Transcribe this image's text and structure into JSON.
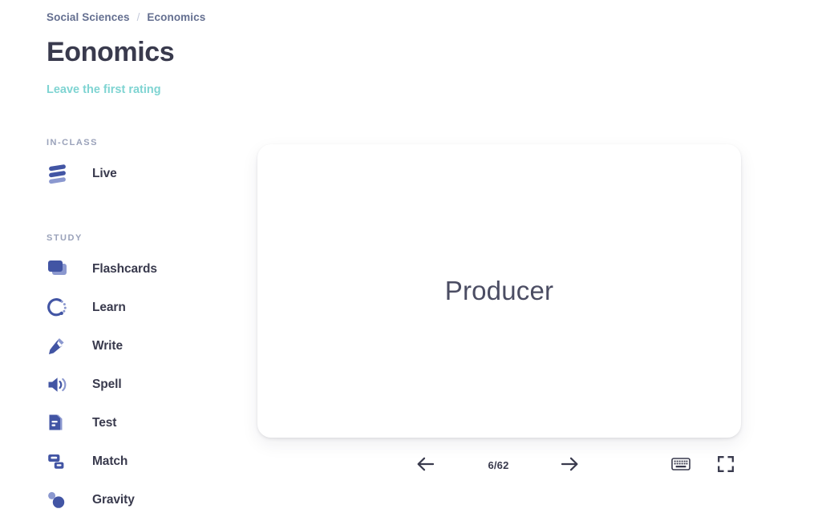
{
  "breadcrumb": {
    "items": [
      "Social Sciences",
      "Economics"
    ],
    "separator": "/"
  },
  "header": {
    "title": "Eonomics",
    "rating_link": "Leave the first rating"
  },
  "sidebar": {
    "groups": [
      {
        "label": "IN-CLASS",
        "items": [
          {
            "label": "Live",
            "icon": "live-bars-icon"
          }
        ]
      },
      {
        "label": "STUDY",
        "items": [
          {
            "label": "Flashcards",
            "icon": "flashcards-stack-icon"
          },
          {
            "label": "Learn",
            "icon": "learn-circle-icon"
          },
          {
            "label": "Write",
            "icon": "write-pen-icon"
          },
          {
            "label": "Spell",
            "icon": "spell-speaker-icon"
          },
          {
            "label": "Test",
            "icon": "test-document-icon"
          },
          {
            "label": "Match",
            "icon": "match-tiles-icon"
          },
          {
            "label": "Gravity",
            "icon": "gravity-asteroid-icon"
          }
        ]
      }
    ]
  },
  "flashcard": {
    "term": "Producer"
  },
  "controls": {
    "prev_label": "previous-card",
    "next_label": "next-card",
    "counter": "6/62",
    "keyboard_label": "keyboard-shortcuts",
    "fullscreen_label": "fullscreen"
  },
  "colors": {
    "icon_dark": "#4255a4",
    "icon_light": "#8b98cf",
    "text_dark": "#393a4d",
    "breadcrumb": "#646f90",
    "teal": "#7fd4d2",
    "muted": "#9aa2ba"
  }
}
